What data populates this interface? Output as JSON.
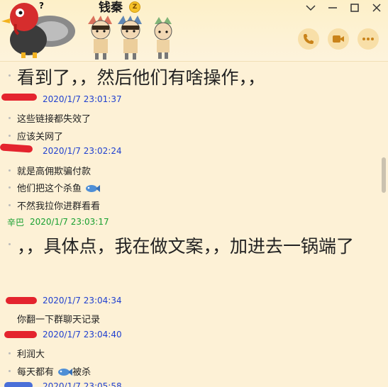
{
  "window": {
    "title": "钱秦",
    "vip_badge": "Z",
    "controls": [
      "minimize",
      "maximize",
      "close"
    ],
    "dropdown_icon": "chevron-down-icon"
  },
  "header_actions": [
    {
      "name": "voice-call",
      "icon": "phone-icon"
    },
    {
      "name": "video-call",
      "icon": "video-icon"
    },
    {
      "name": "more",
      "icon": "more-icon"
    }
  ],
  "messages": [
    {
      "type": "text",
      "big": true,
      "text": "看到了，，然后他们有啥操作，，"
    },
    {
      "type": "sender",
      "time": "2020/1/7 23:01:37"
    },
    {
      "type": "text",
      "text": "这些链接都失效了"
    },
    {
      "type": "text",
      "text": "应该关网了"
    },
    {
      "type": "sender",
      "time": "2020/1/7 23:02:24"
    },
    {
      "type": "text",
      "text": "就是高佣欺骗付款"
    },
    {
      "type": "text",
      "text": "他们把这个杀鱼"
    },
    {
      "type": "text",
      "text": "不然我拉你进群看看"
    },
    {
      "type": "sender",
      "name": "辛巴",
      "time": "2020/1/7 23:03:17"
    },
    {
      "type": "text",
      "big": true,
      "text": "，，具体点，我在做文案，，加进去一锅端了"
    },
    {
      "type": "sender",
      "time": "2020/1/7 23:04:34"
    },
    {
      "type": "text",
      "text": "你翻一下群聊天记录"
    },
    {
      "type": "sender",
      "time": "2020/1/7 23:04:40"
    },
    {
      "type": "text",
      "text": "利润大"
    },
    {
      "type": "text",
      "text": "每天都有"
    },
    {
      "type": "text",
      "text": "被杀"
    },
    {
      "type": "sender",
      "time": "2020/1/7 23:05:58"
    }
  ],
  "colors": {
    "background": "#fdf1d6",
    "timestamp": "#2040d0",
    "sender_green": "#18a030",
    "redaction": "#e4242e",
    "action_button": "#f8dfa8",
    "action_icon": "#c9831a"
  }
}
